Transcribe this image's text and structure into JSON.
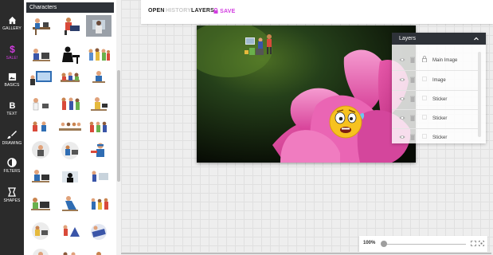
{
  "sidebar": {
    "items": [
      {
        "label": "GALLERY",
        "icon": "home-icon",
        "active": false
      },
      {
        "label": "SALE!",
        "icon": "dollar-icon",
        "active": true
      },
      {
        "label": "BASICS",
        "icon": "image-icon",
        "active": false
      },
      {
        "label": "TEXT",
        "icon": "text-b-icon",
        "active": false
      },
      {
        "label": "DRAWING",
        "icon": "brush-icon",
        "active": false
      },
      {
        "label": "FILTERS",
        "icon": "filters-icon",
        "active": false
      },
      {
        "label": "SHAPES",
        "icon": "shapes-icon",
        "active": false
      }
    ]
  },
  "panel": {
    "title": "Characters"
  },
  "toolbar": {
    "open": "OPEN",
    "history": "HISTORY",
    "layers": "LAYERS",
    "save": "SAVE"
  },
  "layers_panel": {
    "title": "Layers",
    "items": [
      {
        "label": "Main Image",
        "locked": true
      },
      {
        "label": "Image",
        "locked": false
      },
      {
        "label": "Sticker",
        "locked": false
      },
      {
        "label": "Sticker",
        "locked": false
      },
      {
        "label": "Sticker",
        "locked": false
      }
    ]
  },
  "zoom": {
    "label": "100%",
    "level_fraction": 0.0
  },
  "colors": {
    "accent": "#d23de0",
    "rail_bg": "#2b2b2b",
    "header_bg": "#2e3238",
    "flower": "#e24fa6"
  }
}
